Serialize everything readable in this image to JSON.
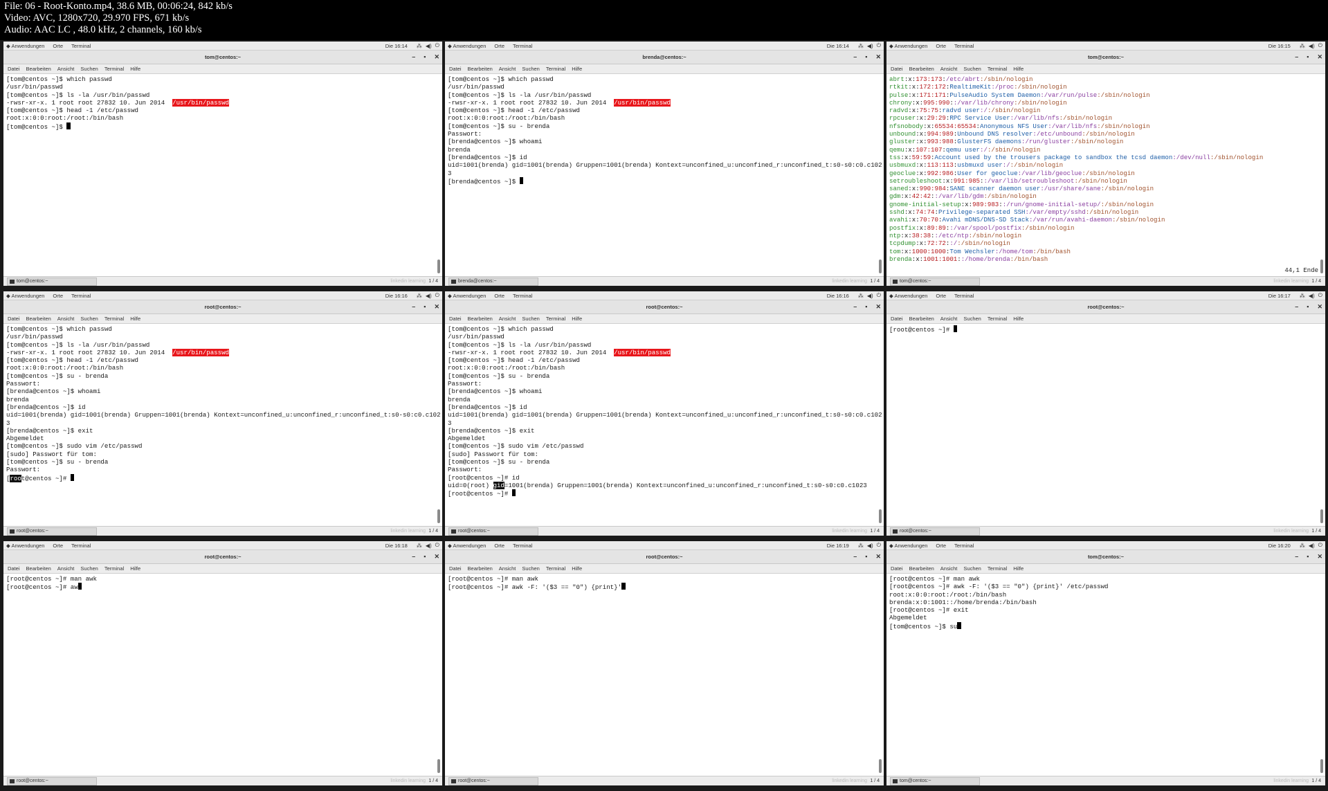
{
  "header": {
    "lines": [
      "File: 06 - Root-Konto.mp4, 38.6 MB, 00:06:24, 842 kb/s",
      "Video: AVC, 1280x720, 29.970 FPS, 671 kb/s",
      "Audio: AAC LC , 48.0 kHz, 2 channels, 160 kb/s"
    ]
  },
  "common": {
    "top_menu": [
      "Anwendungen",
      "Orte",
      "Terminal"
    ],
    "menu": [
      "Datei",
      "Bearbeiten",
      "Ansicht",
      "Suchen",
      "Terminal",
      "Hilfe"
    ],
    "page": "1 / 4",
    "watermark": "linkedin learning",
    "window_controls": [
      "–",
      "▪",
      "✕"
    ]
  },
  "tiles": [
    {
      "clock": "Die 16:14",
      "title": "tom@centos:~",
      "task": "tom@centos:~",
      "lines": [
        {
          "t": "[tom@centos ~]$ which passwd"
        },
        {
          "t": "/usr/bin/passwd"
        },
        {
          "t": "[tom@centos ~]$ ls -la /usr/bin/passwd"
        },
        {
          "t": "-rwsr-xr-x. 1 root root 27832 10. Jun 2014  ",
          "hl": "/usr/bin/passwd"
        },
        {
          "t": "[tom@centos ~]$ head -1 /etc/passwd"
        },
        {
          "t": "root:x:0:0:root:/root:/bin/bash"
        },
        {
          "t": "[tom@centos ~]$ ",
          "cur": true
        }
      ]
    },
    {
      "clock": "Die 16:14",
      "title": "brenda@centos:~",
      "task": "brenda@centos:~",
      "lines": [
        {
          "t": "[tom@centos ~]$ which passwd"
        },
        {
          "t": "/usr/bin/passwd"
        },
        {
          "t": "[tom@centos ~]$ ls -la /usr/bin/passwd"
        },
        {
          "t": "-rwsr-xr-x. 1 root root 27832 10. Jun 2014  ",
          "hl": "/usr/bin/passwd"
        },
        {
          "t": "[tom@centos ~]$ head -1 /etc/passwd"
        },
        {
          "t": "root:x:0:0:root:/root:/bin/bash"
        },
        {
          "t": "[tom@centos ~]$ su - brenda"
        },
        {
          "t": "Passwort:"
        },
        {
          "t": "[brenda@centos ~]$ whoami"
        },
        {
          "t": "brenda"
        },
        {
          "t": "[brenda@centos ~]$ id"
        },
        {
          "t": "uid=1001(brenda) gid=1001(brenda) Gruppen=1001(brenda) Kontext=unconfined_u:unconfined_r:unconfined_t:s0-s0:c0.c102"
        },
        {
          "t": "3"
        },
        {
          "t": "[brenda@centos ~]$ ",
          "cur": true
        }
      ]
    },
    {
      "clock": "Die 16:15",
      "title": "tom@centos:~",
      "task": "tom@centos:~",
      "status": "44,1          Ende",
      "passwd": [
        [
          "abrt",
          ":x:",
          "173:173",
          ":",
          "",
          "/etc/abrt",
          ":/sbin/nologin"
        ],
        [
          "rtkit",
          ":x:",
          "172:172",
          ":",
          "RealtimeKit",
          ":/proc",
          ":/sbin/nologin"
        ],
        [
          "pulse",
          ":x:",
          "171:171",
          ":",
          "PulseAudio System Daemon",
          ":/var/run/pulse",
          ":/sbin/nologin"
        ],
        [
          "chrony",
          ":x:",
          "995:990",
          ":",
          "",
          ":/var/lib/chrony",
          ":/sbin/nologin"
        ],
        [
          "radvd",
          ":x:",
          "75:75",
          ":",
          "radvd user",
          ":/",
          ":/sbin/nologin"
        ],
        [
          "rpcuser",
          ":x:",
          "29:29",
          ":",
          "RPC Service User",
          ":/var/lib/nfs",
          ":/sbin/nologin"
        ],
        [
          "nfsnobody",
          ":x:",
          "65534:65534",
          ":",
          "Anonymous NFS User",
          ":/var/lib/nfs",
          ":/sbin/nologin"
        ],
        [
          "unbound",
          ":x:",
          "994:989",
          ":",
          "Unbound DNS resolver",
          ":/etc/unbound",
          ":/sbin/nologin"
        ],
        [
          "gluster",
          ":x:",
          "993:988",
          ":",
          "GlusterFS daemons",
          ":/run/gluster",
          ":/sbin/nologin"
        ],
        [
          "qemu",
          ":x:",
          "107:107",
          ":",
          "qemu user",
          ":/",
          ":/sbin/nologin"
        ],
        [
          "tss",
          ":x:",
          "59:59",
          ":",
          "Account used by the trousers package to sandbox the tcsd daemon",
          ":/dev/null",
          ":/sbin/nologin"
        ],
        [
          "usbmuxd",
          ":x:",
          "113:113",
          ":",
          "usbmuxd user",
          ":/",
          ":/sbin/nologin"
        ],
        [
          "geoclue",
          ":x:",
          "992:986",
          ":",
          "User for geoclue",
          ":/var/lib/geoclue",
          ":/sbin/nologin"
        ],
        [
          "setroubleshoot",
          ":x:",
          "991:985",
          ":",
          "",
          ":/var/lib/setroubleshoot",
          ":/sbin/nologin"
        ],
        [
          "saned",
          ":x:",
          "990:984",
          ":",
          "SANE scanner daemon user",
          ":/usr/share/sane",
          ":/sbin/nologin"
        ],
        [
          "gdm",
          ":x:",
          "42:42",
          ":",
          "",
          ":/var/lib/gdm",
          ":/sbin/nologin"
        ],
        [
          "gnome-initial-setup",
          ":x:",
          "989:983",
          ":",
          "",
          ":/run/gnome-initial-setup/",
          ":/sbin/nologin"
        ],
        [
          "sshd",
          ":x:",
          "74:74",
          ":",
          "Privilege-separated SSH",
          ":/var/empty/sshd",
          ":/sbin/nologin"
        ],
        [
          "avahi",
          ":x:",
          "70:70",
          ":",
          "Avahi mDNS/DNS-SD Stack",
          ":/var/run/avahi-daemon",
          ":/sbin/nologin"
        ],
        [
          "postfix",
          ":x:",
          "89:89",
          ":",
          "",
          ":/var/spool/postfix",
          ":/sbin/nologin"
        ],
        [
          "ntp",
          ":x:",
          "38:38",
          ":",
          "",
          ":/etc/ntp",
          ":/sbin/nologin"
        ],
        [
          "tcpdump",
          ":x:",
          "72:72",
          ":",
          "",
          ":/",
          ":/sbin/nologin"
        ],
        [
          "tom",
          ":x:",
          "1000:1000",
          ":",
          "Tom Wechsler",
          ":/home/tom",
          ":/bin/bash"
        ],
        [
          "brenda",
          ":x:",
          "1001:1001",
          ":",
          "",
          ":/home/brenda",
          ":/bin/bash"
        ]
      ]
    },
    {
      "clock": "Die 16:16",
      "title": "root@centos:~",
      "task": "root@centos:~",
      "lines": [
        {
          "t": "[tom@centos ~]$ which passwd"
        },
        {
          "t": "/usr/bin/passwd"
        },
        {
          "t": "[tom@centos ~]$ ls -la /usr/bin/passwd"
        },
        {
          "t": "-rwsr-xr-x. 1 root root 27832 10. Jun 2014  ",
          "hl": "/usr/bin/passwd"
        },
        {
          "t": "[tom@centos ~]$ head -1 /etc/passwd"
        },
        {
          "t": "root:x:0:0:root:/root:/bin/bash"
        },
        {
          "t": "[tom@centos ~]$ su - brenda"
        },
        {
          "t": "Passwort:"
        },
        {
          "t": "[brenda@centos ~]$ whoami"
        },
        {
          "t": "brenda"
        },
        {
          "t": "[brenda@centos ~]$ id"
        },
        {
          "t": "uid=1001(brenda) gid=1001(brenda) Gruppen=1001(brenda) Kontext=unconfined_u:unconfined_r:unconfined_t:s0-s0:c0.c102"
        },
        {
          "t": "3"
        },
        {
          "t": "[brenda@centos ~]$ exit"
        },
        {
          "t": "Abgemeldet"
        },
        {
          "t": "[tom@centos ~]$ sudo vim /etc/passwd"
        },
        {
          "t": "[sudo] Passwort für tom:"
        },
        {
          "t": "[tom@centos ~]$ su - brenda"
        },
        {
          "t": "Passwort:"
        },
        {
          "t": "[",
          "sel": "roo",
          "t2": "t@centos ~]# ",
          "cur": true
        }
      ]
    },
    {
      "clock": "Die 16:16",
      "title": "root@centos:~",
      "task": "root@centos:~",
      "lines": [
        {
          "t": "[tom@centos ~]$ which passwd"
        },
        {
          "t": "/usr/bin/passwd"
        },
        {
          "t": "[tom@centos ~]$ ls -la /usr/bin/passwd"
        },
        {
          "t": "-rwsr-xr-x. 1 root root 27832 10. Jun 2014  ",
          "hl": "/usr/bin/passwd"
        },
        {
          "t": "[tom@centos ~]$ head -1 /etc/passwd"
        },
        {
          "t": "root:x:0:0:root:/root:/bin/bash"
        },
        {
          "t": "[tom@centos ~]$ su - brenda"
        },
        {
          "t": "Passwort:"
        },
        {
          "t": "[brenda@centos ~]$ whoami"
        },
        {
          "t": "brenda"
        },
        {
          "t": "[brenda@centos ~]$ id"
        },
        {
          "t": "uid=1001(brenda) gid=1001(brenda) Gruppen=1001(brenda) Kontext=unconfined_u:unconfined_r:unconfined_t:s0-s0:c0.c102"
        },
        {
          "t": "3"
        },
        {
          "t": "[brenda@centos ~]$ exit"
        },
        {
          "t": "Abgemeldet"
        },
        {
          "t": "[tom@centos ~]$ sudo vim /etc/passwd"
        },
        {
          "t": "[sudo] Passwort für tom:"
        },
        {
          "t": "[tom@centos ~]$ su - brenda"
        },
        {
          "t": "Passwort:"
        },
        {
          "t": "[root@centos ~]# id"
        },
        {
          "t": "uid=0(root) ",
          "sel": "gid",
          "t2": "=1001(brenda) Gruppen=1001(brenda) Kontext=unconfined_u:unconfined_r:unconfined_t:s0-s0:c0.c1023"
        },
        {
          "t": "[root@centos ~]# ",
          "cur": true
        }
      ]
    },
    {
      "clock": "Die 16:17",
      "title": "root@centos:~",
      "task": "root@centos:~",
      "lines": [
        {
          "t": "[root@centos ~]# ",
          "cur": true
        }
      ]
    },
    {
      "clock": "Die 16:18",
      "title": "root@centos:~",
      "task": "root@centos:~",
      "lines": [
        {
          "t": "[root@centos ~]# man awk"
        },
        {
          "t": "[root@centos ~]# aw",
          "cur": true
        }
      ]
    },
    {
      "clock": "Die 16:19",
      "title": "root@centos:~",
      "task": "root@centos:~",
      "lines": [
        {
          "t": "[root@centos ~]# man awk"
        },
        {
          "t": "[root@centos ~]# awk -F: '($3 == \"0\") {print}'",
          "cur": true
        }
      ]
    },
    {
      "clock": "Die 16:20",
      "title": "tom@centos:~",
      "task": "tom@centos:~",
      "lines": [
        {
          "t": "[root@centos ~]# man awk"
        },
        {
          "t": "[root@centos ~]# awk -F: '($3 == \"0\") {print}' /etc/passwd"
        },
        {
          "t": "root:x:0:0:root:/root:/bin/bash"
        },
        {
          "t": "brenda:x:0:1001::/home/brenda:/bin/bash"
        },
        {
          "t": "[root@centos ~]# exit"
        },
        {
          "t": "Abgemeldet"
        },
        {
          "t": "[tom@centos ~]$ su",
          "cur": true
        }
      ]
    }
  ]
}
